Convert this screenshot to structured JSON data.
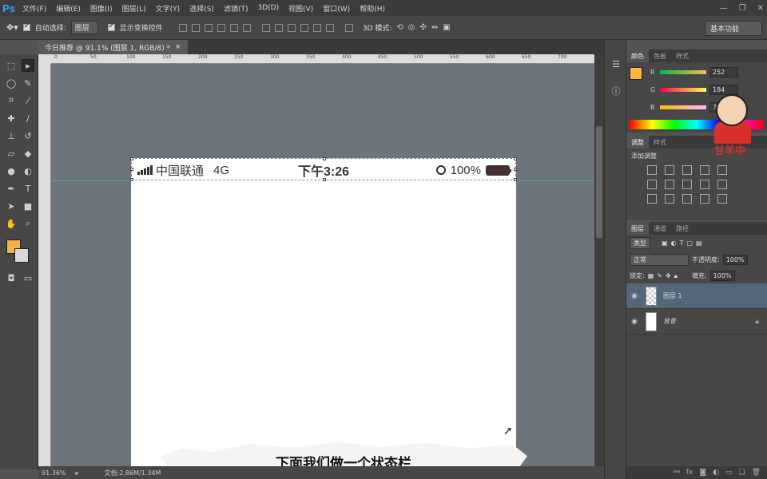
{
  "app": {
    "logo": "Ps"
  },
  "menu": [
    "文件(F)",
    "编辑(E)",
    "图像(I)",
    "图层(L)",
    "文字(Y)",
    "选择(S)",
    "滤镜(T)",
    "3D(D)",
    "视图(V)",
    "窗口(W)",
    "帮助(H)"
  ],
  "options": {
    "auto_select_label": "自动选择:",
    "auto_select_value": "图层",
    "show_transform_label": "显示变换控件",
    "mode_3d_label": "3D 模式:",
    "workspace": "基本功能"
  },
  "document": {
    "tab_title": "今日推荐 @ 91.1% (图层 1, RGB/8) *",
    "close": "×"
  },
  "ruler": {
    "h_ticks": [
      "0",
      "50",
      "100",
      "150",
      "200",
      "250",
      "300",
      "350",
      "400",
      "450",
      "500",
      "550",
      "600",
      "650",
      "700",
      "750"
    ]
  },
  "phone_status": {
    "carrier": "中国联通",
    "network": "4G",
    "time": "下午3:26",
    "battery": "100%"
  },
  "subtitle": "下面我们做一个状态栏",
  "bottom": {
    "zoom": "91.36%",
    "doc_size": "文档:2.86M/1.34M"
  },
  "color_panel": {
    "tabs": [
      "颜色",
      "色板",
      "样式"
    ],
    "r": "252",
    "g": "184",
    "b": "75"
  },
  "adjustments": {
    "tabs": [
      "调整",
      "样式"
    ],
    "title": "添加调整"
  },
  "layers": {
    "tabs": [
      "图层",
      "通道",
      "路径"
    ],
    "kind": "类型",
    "blend": "正常",
    "opacity_label": "不透明度:",
    "opacity": "100%",
    "lock_label": "锁定:",
    "fill_label": "填充:",
    "fill": "100%",
    "items": [
      {
        "name": "图层 1"
      },
      {
        "name": "背景"
      }
    ]
  },
  "watermark": {
    "text": "甘羊中"
  },
  "colors": {
    "foreground": "#f6b142",
    "background": "#d9d9d9",
    "guide": "#36c5c1",
    "canvas_bg": "#6c747b"
  }
}
